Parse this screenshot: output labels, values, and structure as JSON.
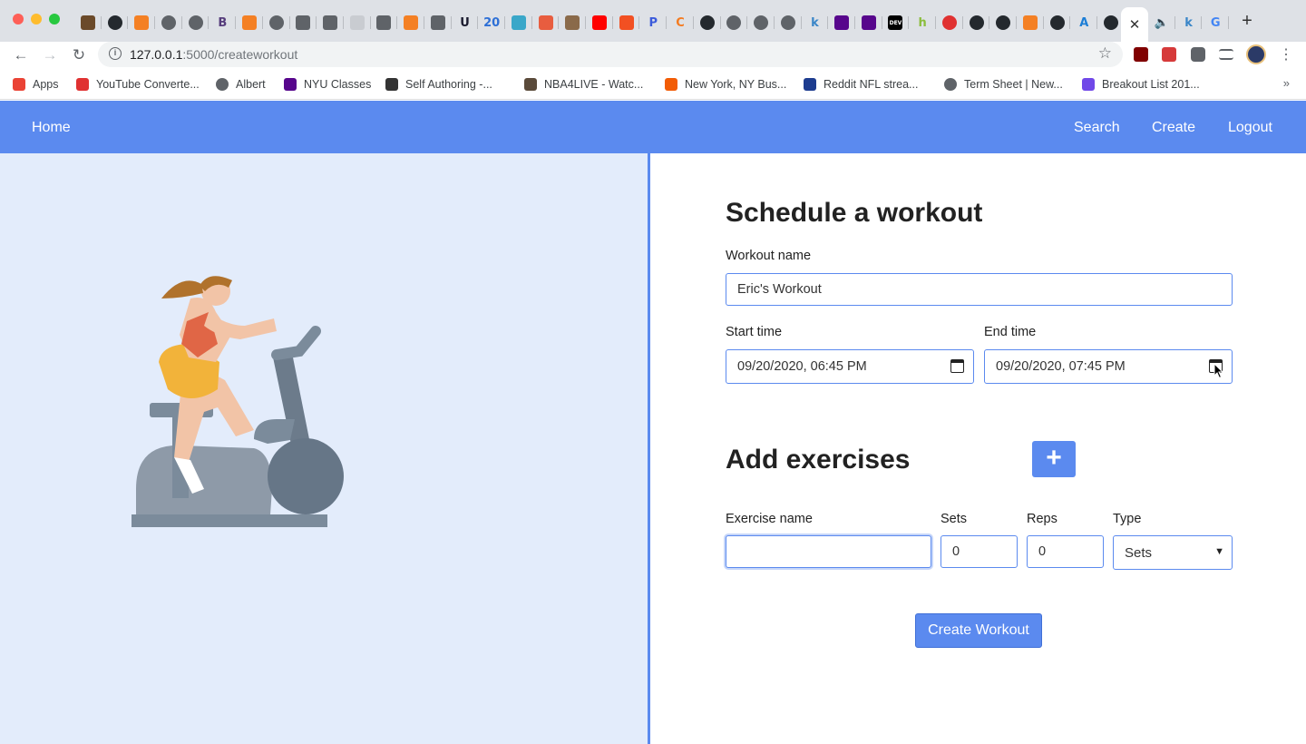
{
  "browser": {
    "tabs": [
      {
        "icon": "face-photo-icon",
        "color": "#6b4a2a",
        "glyph": ""
      },
      {
        "icon": "github-icon",
        "color": "#24292e",
        "glyph": ""
      },
      {
        "icon": "stackoverflow-icon",
        "color": "#f48024",
        "glyph": ""
      },
      {
        "icon": "globe-icon",
        "color": "#5f6368",
        "glyph": ""
      },
      {
        "icon": "target-icon",
        "color": "#5f6368",
        "glyph": ""
      },
      {
        "icon": "bootstrap-icon",
        "color": "#563d7c",
        "glyph": "B"
      },
      {
        "icon": "stackoverflow-icon",
        "color": "#f48024",
        "glyph": ""
      },
      {
        "icon": "globe-icon",
        "color": "#5f6368",
        "glyph": ""
      },
      {
        "icon": "phone-icon",
        "color": "#5f6368",
        "glyph": ""
      },
      {
        "icon": "book-icon",
        "color": "#5f6368",
        "glyph": ""
      },
      {
        "icon": "box-icon",
        "color": "#c9ccd1",
        "glyph": ""
      },
      {
        "icon": "book-icon",
        "color": "#5f6368",
        "glyph": ""
      },
      {
        "icon": "stackoverflow-icon",
        "color": "#f48024",
        "glyph": ""
      },
      {
        "icon": "book-icon",
        "color": "#5f6368",
        "glyph": ""
      },
      {
        "icon": "u-icon",
        "color": "#1a1a2e",
        "glyph": "U"
      },
      {
        "icon": "calendar-icon",
        "color": "#2d6fd6",
        "glyph": "20"
      },
      {
        "icon": "map-icon",
        "color": "#3aa7c9",
        "glyph": ""
      },
      {
        "icon": "chart-icon",
        "color": "#e85d3f",
        "glyph": ""
      },
      {
        "icon": "photo-icon",
        "color": "#8a6a4a",
        "glyph": ""
      },
      {
        "icon": "youtube-icon",
        "color": "#ff0000",
        "glyph": ""
      },
      {
        "icon": "microsoft-icon",
        "color": "#f25022",
        "glyph": ""
      },
      {
        "icon": "paypal-icon",
        "color": "#3b5bdb",
        "glyph": "P"
      },
      {
        "icon": "c-icon",
        "color": "#f47b20",
        "glyph": "C"
      },
      {
        "icon": "github-icon",
        "color": "#24292e",
        "glyph": ""
      },
      {
        "icon": "globe-icon",
        "color": "#5f6368",
        "glyph": ""
      },
      {
        "icon": "globe-icon",
        "color": "#5f6368",
        "glyph": ""
      },
      {
        "icon": "globe-icon",
        "color": "#5f6368",
        "glyph": ""
      },
      {
        "icon": "k-icon",
        "color": "#3a86c8",
        "glyph": "k"
      },
      {
        "icon": "nyu-icon",
        "color": "#57068c",
        "glyph": ""
      },
      {
        "icon": "nyu-icon",
        "color": "#57068c",
        "glyph": ""
      },
      {
        "icon": "dev-icon",
        "color": "#000000",
        "glyph": "DEV"
      },
      {
        "icon": "h-icon",
        "color": "#8bbd3c",
        "glyph": "h"
      },
      {
        "icon": "record-icon",
        "color": "#e03131",
        "glyph": ""
      },
      {
        "icon": "github-icon",
        "color": "#24292e",
        "glyph": ""
      },
      {
        "icon": "github-icon",
        "color": "#24292e",
        "glyph": ""
      },
      {
        "icon": "stackoverflow-icon",
        "color": "#f48024",
        "glyph": ""
      },
      {
        "icon": "github-icon",
        "color": "#24292e",
        "glyph": ""
      },
      {
        "icon": "appstore-icon",
        "color": "#1c7ed6",
        "glyph": "A"
      },
      {
        "icon": "github-icon",
        "color": "#24292e",
        "glyph": ""
      }
    ],
    "active_tab_close": "✕",
    "after_tabs": [
      {
        "icon": "speaker-icon",
        "color": "#5f6368",
        "glyph": "🔈"
      },
      {
        "icon": "k-icon",
        "color": "#3a86c8",
        "glyph": "k"
      },
      {
        "icon": "google-icon",
        "color": "#4285f4",
        "glyph": "G"
      }
    ],
    "new_tab": "+",
    "url_host": "127.0.0.1",
    "url_path": ":5000/createworkout",
    "bookmarks": [
      {
        "label": "Apps",
        "icon": "apps-grid-icon",
        "color": "#ea4335"
      },
      {
        "label": "YouTube Converte...",
        "icon": "download-icon",
        "color": "#e03131"
      },
      {
        "label": "Albert",
        "icon": "globe-icon",
        "color": "#5f6368"
      },
      {
        "label": "NYU Classes",
        "icon": "nyu-icon",
        "color": "#57068c"
      },
      {
        "label": "Self Authoring -...",
        "icon": "pen-icon",
        "color": "#333333"
      },
      {
        "label": "NBA4LIVE - Watc...",
        "icon": "player-icon",
        "color": "#5a4a3a"
      },
      {
        "label": "New York, NY Bus...",
        "icon": "e-icon",
        "color": "#f25c05"
      },
      {
        "label": "Reddit NFL strea...",
        "icon": "helmet-icon",
        "color": "#1d3c8f"
      },
      {
        "label": "Term Sheet | New...",
        "icon": "globe-icon",
        "color": "#5f6368"
      },
      {
        "label": "Breakout List 201...",
        "icon": "rocket-icon",
        "color": "#7048e8"
      }
    ],
    "bookmarks_more": "»"
  },
  "nav": {
    "home": "Home",
    "search": "Search",
    "create": "Create",
    "logout": "Logout"
  },
  "form": {
    "title": "Schedule a workout",
    "workout_name_label": "Workout name",
    "workout_name_value": "Eric's Workout",
    "start_time_label": "Start time",
    "start_time_value": "09/20/2020, 06:45 PM",
    "end_time_label": "End time",
    "end_time_value": "09/20/2020, 07:45 PM",
    "exercises_title": "Add exercises",
    "add_button": "+",
    "exercise_name_label": "Exercise name",
    "exercise_name_value": "",
    "sets_label": "Sets",
    "sets_value": "0",
    "reps_label": "Reps",
    "reps_value": "0",
    "type_label": "Type",
    "type_value": "Sets",
    "submit": "Create Workout"
  },
  "colors": {
    "primary": "#5b8aef",
    "left_panel_bg": "#e3ecfb"
  }
}
